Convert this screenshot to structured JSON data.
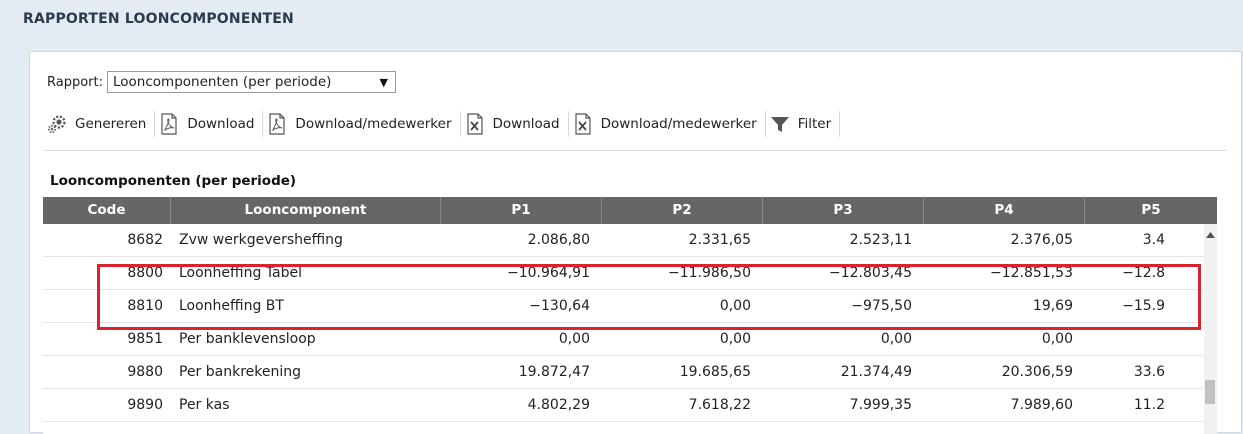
{
  "page": {
    "title": "RAPPORTEN LOONCOMPONENTEN"
  },
  "report_select": {
    "label": "Rapport:",
    "value": "Looncomponenten (per periode)"
  },
  "toolbar": {
    "items": [
      {
        "label": "Genereren",
        "icon": "gears-icon"
      },
      {
        "label": "Download",
        "icon": "pdf-icon"
      },
      {
        "label": "Download/medewerker",
        "icon": "pdf-icon"
      },
      {
        "label": "Download",
        "icon": "excel-icon"
      },
      {
        "label": "Download/medewerker",
        "icon": "excel-icon"
      },
      {
        "label": "Filter",
        "icon": "filter-icon"
      }
    ]
  },
  "section": {
    "title": "Looncomponenten (per periode)"
  },
  "table": {
    "columns": [
      "Code",
      "Looncomponent",
      "P1",
      "P2",
      "P3",
      "P4",
      "P5"
    ],
    "rows": [
      {
        "code": "8682",
        "name": "Zvw werkgeversheffing",
        "p1": "2.086,80",
        "p2": "2.331,65",
        "p3": "2.523,11",
        "p4": "2.376,05",
        "p5": "3.4"
      },
      {
        "code": "8800",
        "name": "Loonheffing Tabel",
        "p1": "−10.964,91",
        "p2": "−11.986,50",
        "p3": "−12.803,45",
        "p4": "−12.851,53",
        "p5": "−12.8"
      },
      {
        "code": "8810",
        "name": "Loonheffing BT",
        "p1": "−130,64",
        "p2": "0,00",
        "p3": "−975,50",
        "p4": "19,69",
        "p5": "−15.9"
      },
      {
        "code": "9851",
        "name": "Per banklevensloop",
        "p1": "0,00",
        "p2": "0,00",
        "p3": "0,00",
        "p4": "0,00",
        "p5": ""
      },
      {
        "code": "9880",
        "name": "Per bankrekening",
        "p1": "19.872,47",
        "p2": "19.685,65",
        "p3": "21.374,49",
        "p4": "20.306,59",
        "p5": "33.6"
      },
      {
        "code": "9890",
        "name": "Per kas",
        "p1": "4.802,29",
        "p2": "7.618,22",
        "p3": "7.999,35",
        "p4": "7.989,60",
        "p5": "11.2"
      }
    ]
  },
  "colors": {
    "highlight": "#d9232d",
    "header_bg": "#666666",
    "page_bg": "#e4ebf3"
  }
}
